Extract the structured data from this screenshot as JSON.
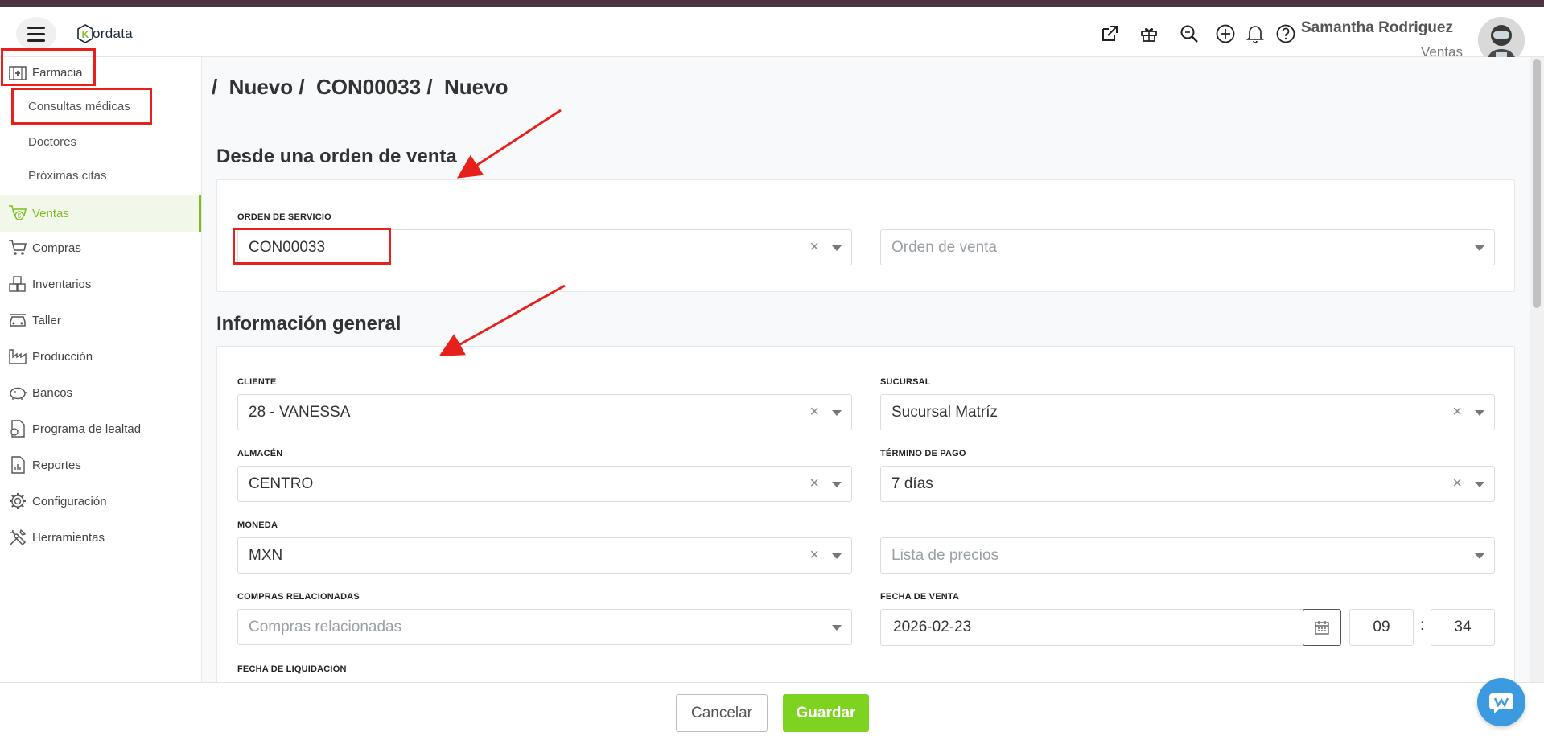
{
  "header": {
    "logo_text": "ordata",
    "logo_letter": "K",
    "user_name": "Samantha Rodriguez",
    "user_role": "Ventas",
    "icons": [
      "external-link-icon",
      "gift-icon",
      "search-zoom-icon",
      "plus-circle-icon",
      "bell-icon",
      "help-icon"
    ]
  },
  "sidebar": {
    "farmacia": "Farmacia",
    "sub": [
      "Consultas médicas",
      "Doctores",
      "Próximas citas"
    ],
    "items": [
      "Ventas",
      "Compras",
      "Inventarios",
      "Taller",
      "Producción",
      "Bancos",
      "Programa de lealtad",
      "Reportes",
      "Configuración",
      "Herramientas"
    ]
  },
  "breadcrumb": "/  Nuevo /  CON00033 /  Nuevo",
  "section1": {
    "title": "Desde una orden de venta",
    "orden_servicio_label": "ORDEN DE SERVICIO",
    "orden_servicio_value": "CON00033",
    "orden_venta_placeholder": "Orden de venta"
  },
  "section2": {
    "title": "Información general",
    "cliente_label": "CLIENTE",
    "cliente_value": "28 - VANESSA",
    "sucursal_label": "SUCURSAL",
    "sucursal_value": "Sucursal Matríz",
    "almacen_label": "ALMACÉN",
    "almacen_value": "CENTRO",
    "termino_label": "TÉRMINO DE PAGO",
    "termino_value": "7 días",
    "moneda_label": "MONEDA",
    "moneda_value": "MXN",
    "lista_placeholder": "Lista de precios",
    "compras_label": "COMPRAS RELACIONADAS",
    "compras_placeholder": "Compras relacionadas",
    "fecha_venta_label": "FECHA DE VENTA",
    "fecha_venta_value": "2026-02-23",
    "hour": "09",
    "minute": "34",
    "time_sep": ":",
    "fecha_liq_label": "FECHA DE LIQUIDACIÓN"
  },
  "footer": {
    "cancel_label": "Cancelar",
    "save_label": "Guardar"
  },
  "colors": {
    "accent_green": "#7ed321",
    "active_green": "#7cbf1e",
    "annotation_red": "#e8201c",
    "chat_blue": "#3c9be0",
    "top_stripe": "#4a3540"
  }
}
